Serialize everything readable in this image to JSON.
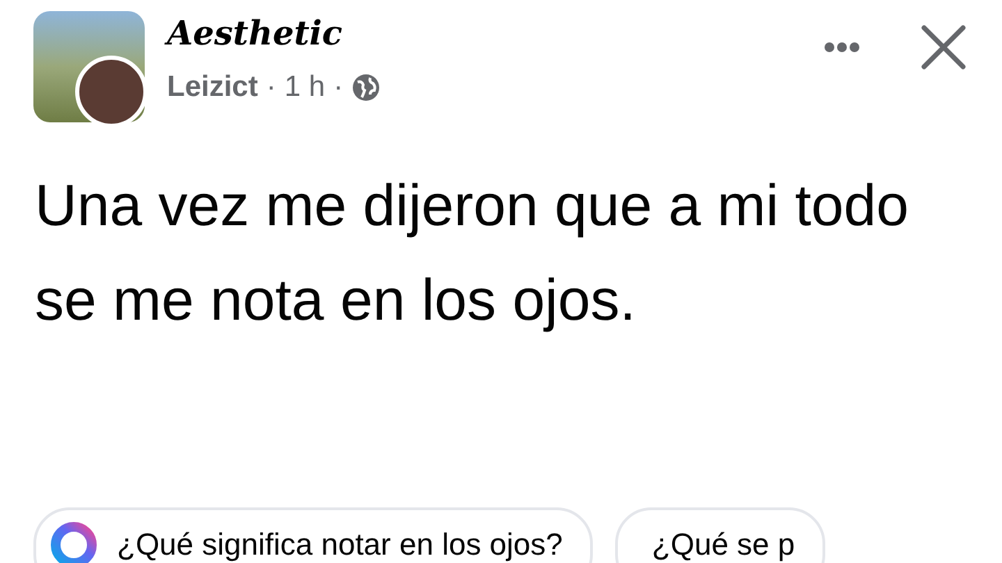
{
  "post": {
    "group": "Aesthetic",
    "author": "Leizict",
    "separator_1": "·",
    "time": "1 h",
    "separator_2": "·",
    "text": "Una vez me dijeron que a mi todo se me nota en los ojos."
  },
  "suggestions": [
    {
      "text": "¿Qué significa notar en los ojos?",
      "kind": "ai"
    },
    {
      "text": "¿Qué se p",
      "kind": "plain"
    }
  ]
}
